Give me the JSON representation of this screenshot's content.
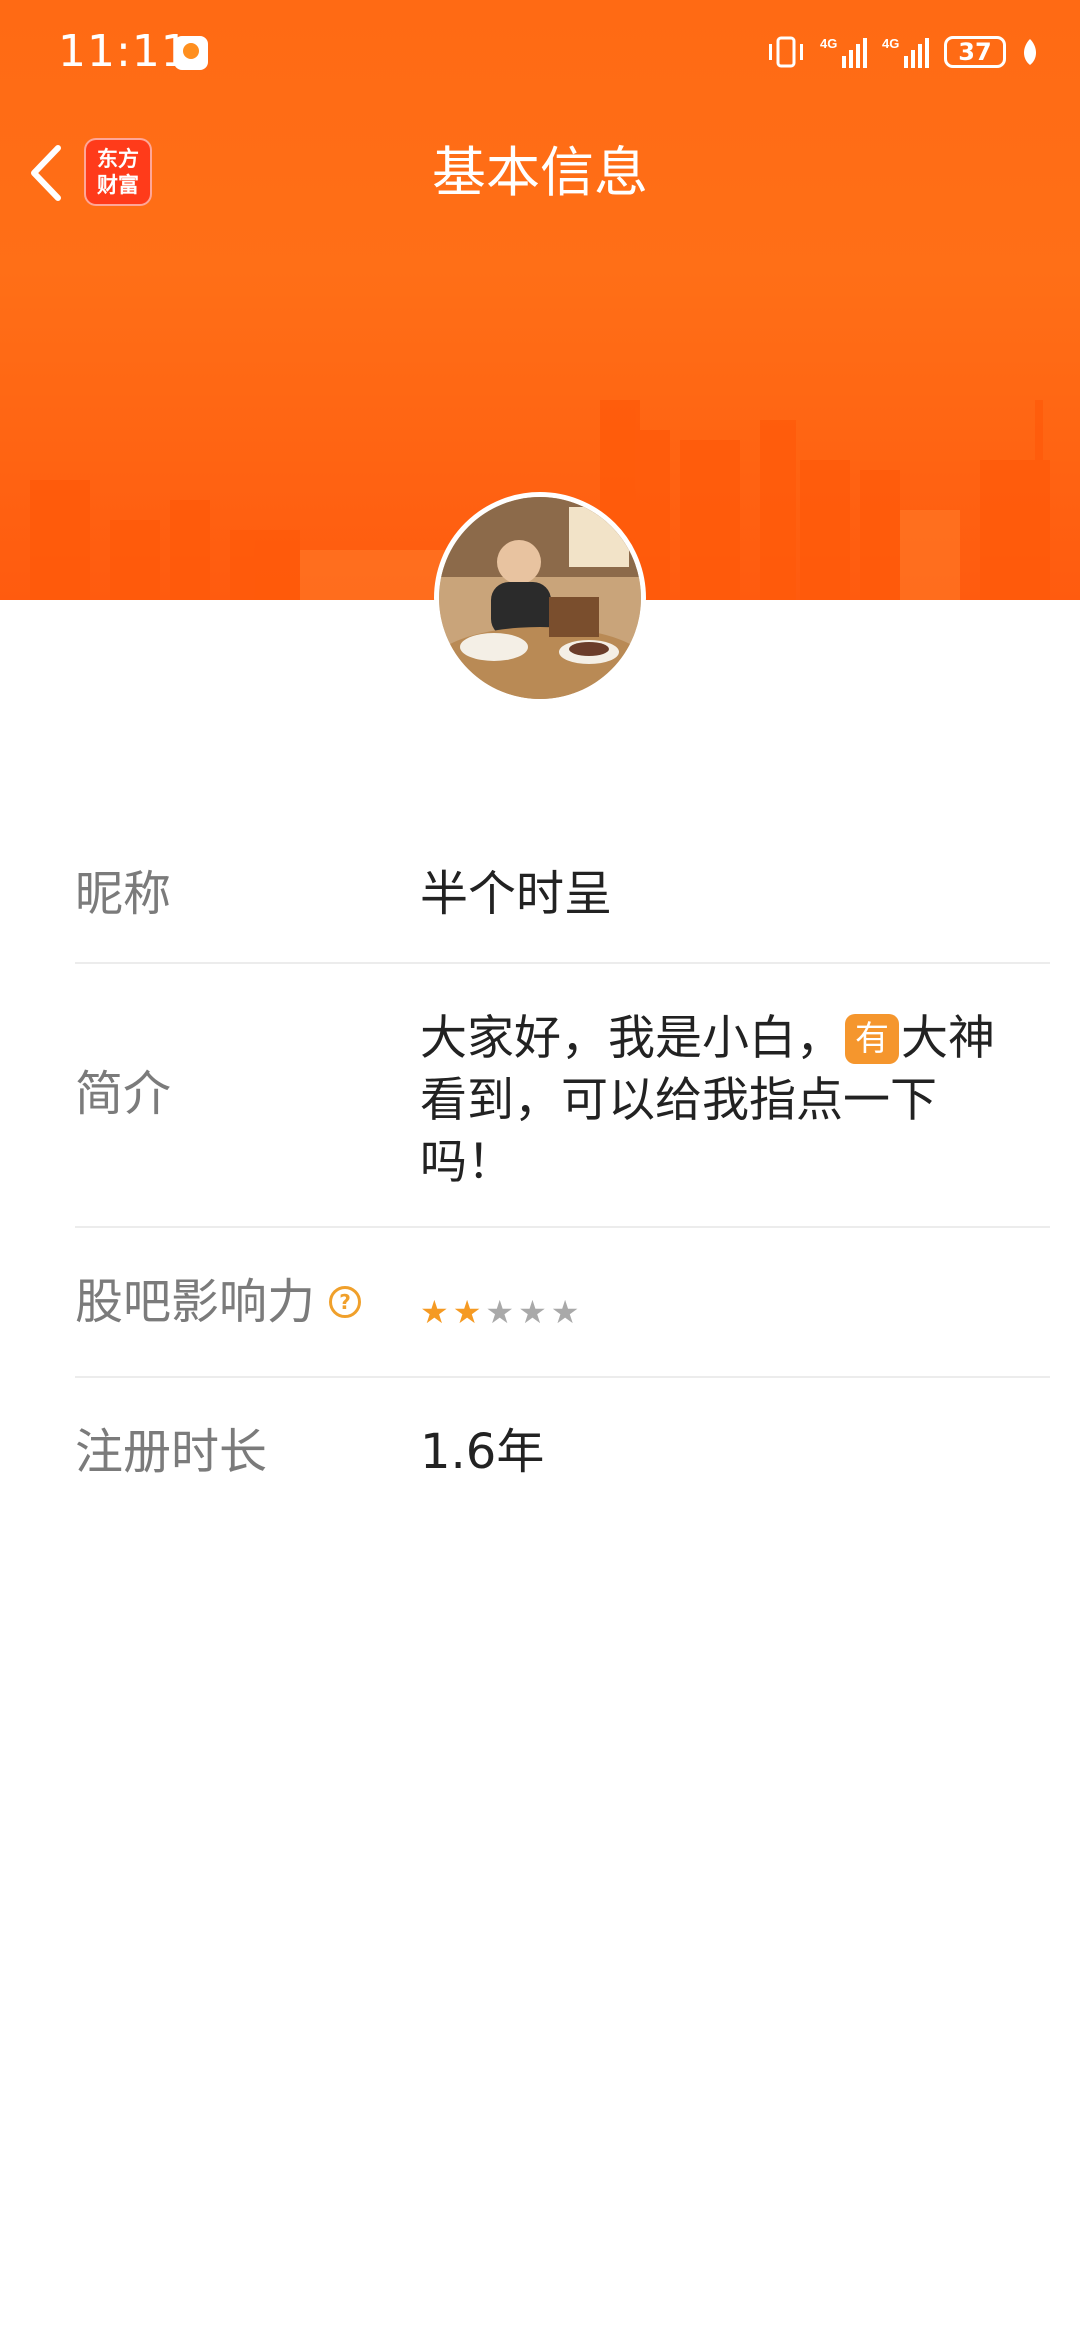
{
  "status_bar": {
    "time": "11:11",
    "battery": "37",
    "network_1": "4G",
    "network_2": "4G"
  },
  "nav": {
    "title": "基本信息",
    "brand_line1": "东方",
    "brand_line2": "财富"
  },
  "profile": {
    "nickname_label": "昵称",
    "nickname_value": "半个时呈",
    "intro_label": "简介",
    "intro_part1": "大家好，我是小白，",
    "intro_tag": "有",
    "intro_part2": "大神看到，可以给我指点一下吗！",
    "influence_label": "股吧影响力",
    "influence_help": "?",
    "influence_rating": 2,
    "influence_max": 5,
    "register_label": "注册时长",
    "register_value": "1.6年"
  },
  "colors": {
    "header_orange": "#ff6a14",
    "star_active": "#f59a23",
    "star_inactive": "#a9a9a9"
  }
}
